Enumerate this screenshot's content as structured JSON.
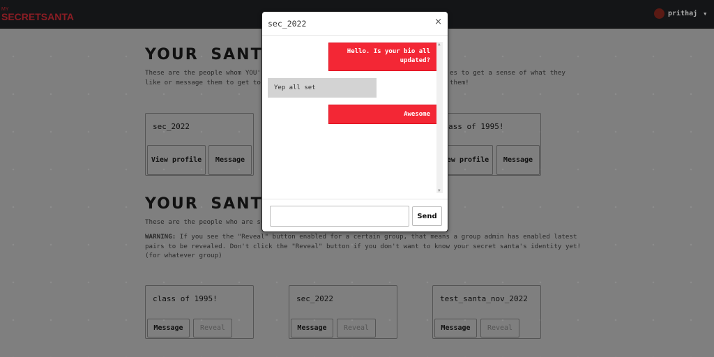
{
  "nav": {
    "logo_top": "MY",
    "logo_name": "SECRETSANTA",
    "username": "prithaj"
  },
  "santees": {
    "heading": "YOUR SANT",
    "desc_left_1": "These are the people whom YOU're",
    "desc_left_2": "like or message them to get to k",
    "desc_right_1": "es to get a sense of what they",
    "desc_right_2": "them!",
    "cards": [
      {
        "name": "sec_2022",
        "view": "View profile",
        "message": "Message"
      },
      {
        "name": "ass of 1995!",
        "view": "View profile",
        "message": "Message"
      }
    ]
  },
  "santas": {
    "heading": "YOUR SANT",
    "desc": "These are the people who are sup",
    "warning_label": "WARNING:",
    "warning_1": " If you see the \"Reveal\" button enabled for a certain group, that means a group admin has enabled latest",
    "warning_2": "pairs to be revealed. Don't click the \"Reveal\" button if you don't want to know your secret santa's identity yet!",
    "warning_3": "(for whatever group)",
    "cards": [
      {
        "name": "class of 1995!",
        "message": "Message",
        "reveal": "Reveal"
      },
      {
        "name": "sec_2022",
        "message": "Message",
        "reveal": "Reveal"
      },
      {
        "name": "test_santa_nov_2022",
        "message": "Message",
        "reveal": "Reveal"
      }
    ]
  },
  "modal": {
    "title": "sec_2022",
    "close": "×",
    "messages": [
      {
        "from": "me",
        "text": "Hello. Is your bio all updated?"
      },
      {
        "from": "them",
        "text": "Yep all set"
      },
      {
        "from": "me",
        "text": "Awesome"
      }
    ],
    "input_value": "",
    "send": "Send"
  },
  "colors": {
    "accent": "#f32735",
    "nav": "#141517"
  }
}
